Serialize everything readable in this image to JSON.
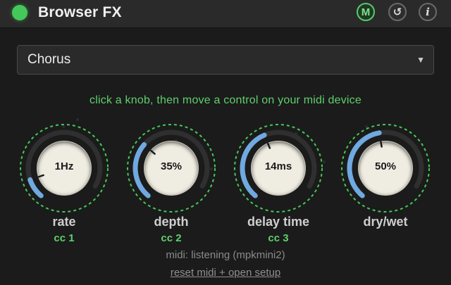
{
  "header": {
    "title": "Browser FX",
    "power_icon": "power-led-icon",
    "midi_button_label": "M",
    "reset_button_icon": "↺",
    "info_button_icon": "i"
  },
  "effect_select": {
    "selected": "Chorus",
    "caret": "▼"
  },
  "hint": "click a knob, then move a control on your midi device",
  "knobs": [
    {
      "label": "rate",
      "value": "1Hz",
      "cc": "cc 1",
      "level": 0.12
    },
    {
      "label": "depth",
      "value": "35%",
      "cc": "cc 2",
      "level": 0.35
    },
    {
      "label": "delay time",
      "value": "14ms",
      "cc": "cc 3",
      "level": 0.45
    },
    {
      "label": "dry/wet",
      "value": "50%",
      "cc": "",
      "level": 0.5
    }
  ],
  "midi_status": "midi: listening (mpkmini2)",
  "reset_link": "reset midi + open setup",
  "colors": {
    "accent": "#45c85a",
    "arc": "#6fa9e0",
    "track": "#2f2f2f",
    "knob_face": "#efece2"
  }
}
